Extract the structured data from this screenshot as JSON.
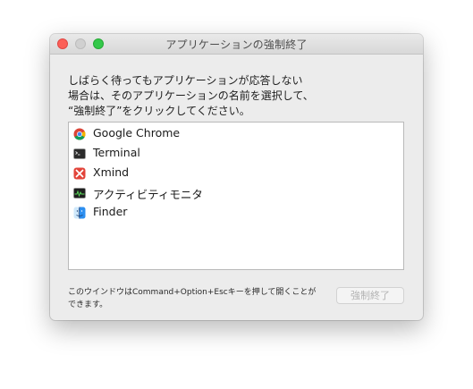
{
  "window": {
    "title": "アプリケーションの強制終了"
  },
  "instructions": {
    "line1": "しばらく待ってもアプリケーションが応答しない",
    "line2": "場合は、そのアプリケーションの名前を選択して、",
    "line3": "“強制終了”をクリックしてください。"
  },
  "apps": [
    {
      "name": "Google Chrome",
      "icon": "chrome-icon"
    },
    {
      "name": "Terminal",
      "icon": "terminal-icon"
    },
    {
      "name": "Xmind",
      "icon": "xmind-icon"
    },
    {
      "name": "アクティビティモニタ",
      "icon": "activity-monitor-icon"
    },
    {
      "name": "Finder",
      "icon": "finder-icon"
    }
  ],
  "footer": {
    "note_line1": "このウインドウはCommand+Option+Escキーを押して開くことが",
    "note_line2": "できます。",
    "force_quit_label": "強制終了"
  },
  "colors": {
    "close": "#fc5f57",
    "minimize_disabled": "#d0d0d0",
    "maximize": "#34c84a",
    "button_disabled_text": "#b3b3b3"
  }
}
